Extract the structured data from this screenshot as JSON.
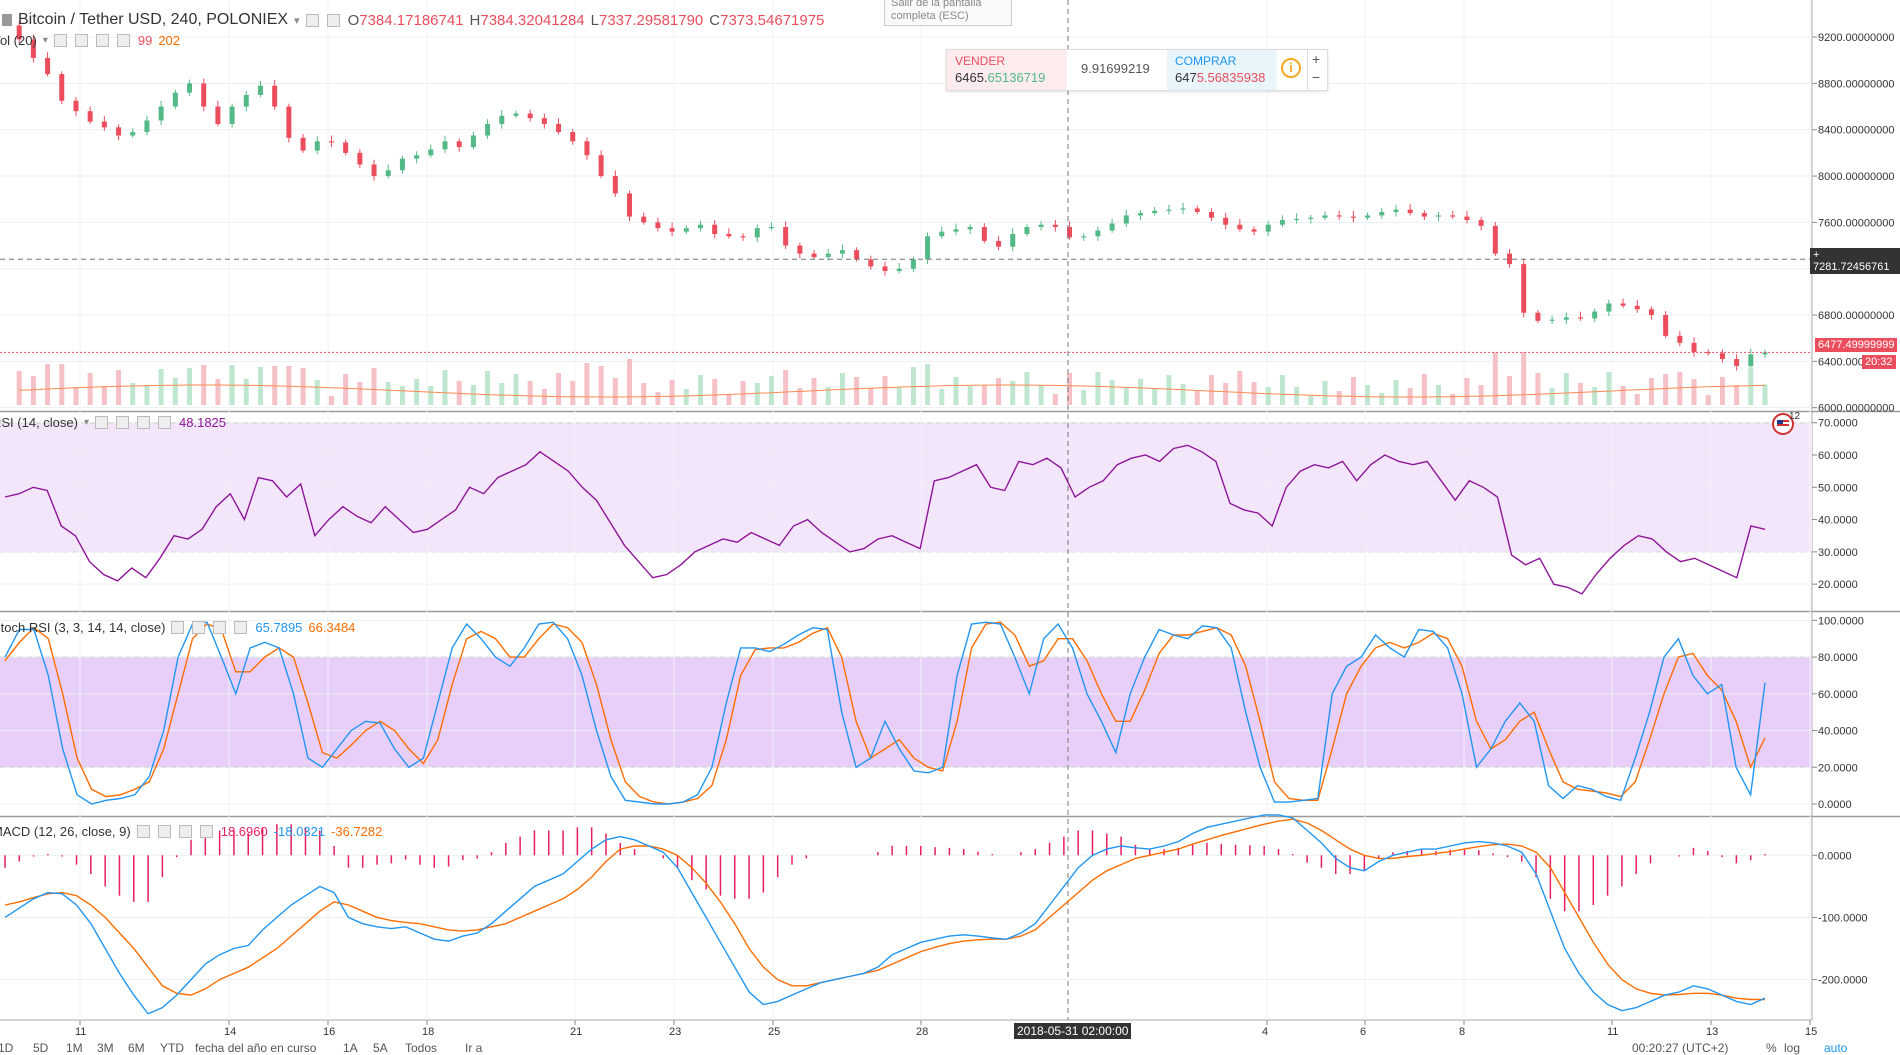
{
  "header": {
    "symbol": "Bitcoin / Tether USD, 240, POLONIEX",
    "ohlc": {
      "o_label": "O",
      "o": "7384.17186741",
      "h_label": "H",
      "h": "7384.32041284",
      "l_label": "L",
      "l": "7337.29581790",
      "c_label": "C",
      "c": "7373.54671975"
    }
  },
  "volume_legend": {
    "label": "Vol (20)",
    "v1": "99",
    "v2": "202"
  },
  "rsi_legend": {
    "label": "RSI (14, close)",
    "value": "48.1825"
  },
  "stoch_legend": {
    "label": "Stoch RSI (3, 3, 14, 14, close)",
    "k": "65.7895",
    "d": "66.3484"
  },
  "macd_legend": {
    "label": "MACD (12, 26, close, 9)",
    "hist": "18.6960",
    "macd": "-18.0321",
    "signal": "-36.7282"
  },
  "tooltip": {
    "text": "Salir de la pantalla completa (ESC)"
  },
  "trade_panel": {
    "sell_label": "VENDER",
    "sell_price_a": "6465.",
    "sell_price_b": "65136719",
    "spread": "9.91699219",
    "buy_label": "COMPRAR",
    "buy_price_a": "647",
    "buy_price_b": "5.56835938",
    "info_icon": "info-icon",
    "plus": "+",
    "minus": "−"
  },
  "price_badges": {
    "crosshair_price": "7281.72456761",
    "last_price": "6477.49999999",
    "countdown": "20:32",
    "flag_count": "12"
  },
  "crosshair_date": "2018-05-31 02:00:00",
  "bottom_bar": {
    "ranges": [
      "1D",
      "5D",
      "1M",
      "3M",
      "6M",
      "YTD",
      "fecha del año en curso",
      "1A",
      "5A",
      "Todos",
      "Ir a"
    ],
    "clock": "00:20:27 (UTC+2)",
    "toggles": [
      "%",
      "log",
      "auto"
    ]
  },
  "colors": {
    "up": "#53b987",
    "down": "#eb4d5c",
    "rsi": "#8e1599",
    "rsi_band": "#f3e6fb",
    "stoch_k": "#2196f3",
    "stoch_d": "#ff6d00",
    "stoch_band": "#e8cffa",
    "macd": "#2196f3",
    "signal": "#ff6d00",
    "hist": "#e91e63"
  },
  "chart_data": [
    {
      "type": "candlestick",
      "title": "Bitcoin / Tether USD, 240, POLONIEX",
      "x_ticks": [
        "11",
        "14",
        "16",
        "18",
        "21",
        "23",
        "25",
        "28",
        "4",
        "6",
        "8",
        "11",
        "13",
        "15"
      ],
      "y_ticks": [
        "9200.00000000",
        "8800.00000000",
        "8400.00000000",
        "8000.00000000",
        "7600.00000000",
        "7200.00000000",
        "6800.00000000",
        "6400.00000000",
        "6000.00000000"
      ],
      "ylim": [
        5980,
        9520
      ],
      "close_path": [
        9300,
        9180,
        9020,
        8880,
        8650,
        8560,
        8470,
        8420,
        8350,
        8380,
        8480,
        8600,
        8720,
        8800,
        8600,
        8450,
        8600,
        8700,
        8780,
        8600,
        8330,
        8220,
        8300,
        8290,
        8200,
        8100,
        8000,
        8050,
        8150,
        8180,
        8230,
        8300,
        8250,
        8350,
        8450,
        8520,
        8540,
        8500,
        8450,
        8380,
        8300,
        8180,
        8000,
        7850,
        7650,
        7600,
        7550,
        7520,
        7550,
        7580,
        7500,
        7480,
        7470,
        7550,
        7560,
        7400,
        7330,
        7300,
        7330,
        7360,
        7280,
        7220,
        7180,
        7200,
        7280,
        7480,
        7520,
        7540,
        7560,
        7440,
        7390,
        7500,
        7560,
        7580,
        7560,
        7470,
        7480,
        7530,
        7590,
        7660,
        7680,
        7700,
        7710,
        7720,
        7690,
        7640,
        7580,
        7540,
        7520,
        7580,
        7620,
        7630,
        7640,
        7660,
        7650,
        7640,
        7660,
        7690,
        7710,
        7680,
        7650,
        7660,
        7650,
        7620,
        7570,
        7330,
        7240,
        6820,
        6750,
        6760,
        6780,
        6770,
        6830,
        6900,
        6880,
        6850,
        6800,
        6620,
        6560,
        6480,
        6470,
        6420,
        6360,
        6460,
        6477
      ]
    },
    {
      "type": "bar",
      "title": "Vol (20)",
      "note": "volume bars with 20-period moving average overlaid on price pane",
      "ylim": [
        0,
        300
      ]
    },
    {
      "type": "line",
      "title": "RSI (14, close)",
      "y_ticks": [
        "70.0000",
        "60.0000",
        "50.0000",
        "40.0000",
        "30.0000",
        "20.0000"
      ],
      "ylim": [
        12,
        73
      ],
      "band": [
        30,
        70
      ],
      "series": [
        {
          "values": [
            47,
            48,
            50,
            49,
            38,
            35,
            27,
            23,
            21,
            25,
            22,
            28,
            35,
            34,
            37,
            44,
            48,
            40,
            53,
            52,
            47,
            51,
            35,
            40,
            44,
            41,
            39,
            44,
            40,
            36,
            37,
            40,
            43,
            50,
            48,
            53,
            55,
            57,
            61,
            58,
            55,
            50,
            46,
            39,
            32,
            27,
            22,
            23,
            26,
            30,
            32,
            34,
            33,
            36,
            34,
            32,
            38,
            40,
            36,
            33,
            30,
            31,
            34,
            35,
            33,
            31,
            52,
            53,
            55,
            57,
            50,
            49,
            58,
            57,
            59,
            56,
            47,
            50,
            52,
            57,
            59,
            60,
            58,
            62,
            63,
            61,
            58,
            45,
            43,
            42,
            38,
            50,
            55,
            57,
            56,
            58,
            52,
            57,
            60,
            58,
            57,
            58,
            52,
            46,
            52,
            50,
            47,
            29,
            26,
            28,
            20,
            19,
            17,
            23,
            28,
            32,
            35,
            34,
            30,
            27,
            28,
            26,
            24,
            22,
            38,
            37
          ]
        }
      ]
    },
    {
      "type": "line",
      "title": "Stoch RSI (3, 3, 14, 14, close)",
      "y_ticks": [
        "100.0000",
        "80.0000",
        "60.0000",
        "40.0000",
        "20.0000",
        "0.0000"
      ],
      "ylim": [
        -6,
        104
      ],
      "band": [
        20,
        80
      ],
      "series": [
        {
          "name": "K",
          "values": [
            80,
            95,
            95,
            70,
            30,
            5,
            0,
            2,
            3,
            5,
            15,
            40,
            80,
            98,
            99,
            80,
            60,
            85,
            88,
            85,
            60,
            25,
            20,
            30,
            40,
            45,
            44,
            30,
            20,
            25,
            55,
            85,
            98,
            90,
            80,
            75,
            85,
            98,
            99,
            90,
            70,
            40,
            15,
            2,
            1,
            0,
            0,
            1,
            5,
            20,
            55,
            85,
            85,
            83,
            87,
            92,
            96,
            95,
            50,
            20,
            25,
            45,
            30,
            18,
            17,
            20,
            70,
            98,
            99,
            98,
            80,
            60,
            90,
            98,
            85,
            60,
            45,
            28,
            60,
            80,
            95,
            92,
            90,
            97,
            96,
            85,
            50,
            20,
            1,
            1,
            2,
            3,
            60,
            75,
            80,
            92,
            85,
            80,
            95,
            94,
            85,
            60,
            20,
            30,
            45,
            55,
            45,
            10,
            3,
            10,
            8,
            4,
            2,
            25,
            50,
            80,
            90,
            70,
            60,
            65,
            20,
            5,
            66
          ]
        },
        {
          "name": "D",
          "values": [
            78,
            88,
            96,
            90,
            60,
            25,
            8,
            4,
            5,
            8,
            12,
            30,
            60,
            90,
            98,
            95,
            72,
            72,
            80,
            85,
            80,
            55,
            28,
            25,
            32,
            40,
            45,
            40,
            30,
            22,
            35,
            65,
            90,
            94,
            90,
            80,
            80,
            90,
            98,
            96,
            88,
            65,
            35,
            12,
            4,
            1,
            0,
            1,
            3,
            10,
            35,
            70,
            84,
            85,
            85,
            88,
            93,
            96,
            80,
            45,
            25,
            30,
            35,
            25,
            20,
            18,
            45,
            85,
            98,
            99,
            92,
            75,
            78,
            90,
            90,
            78,
            60,
            45,
            45,
            62,
            82,
            92,
            92,
            94,
            96,
            92,
            75,
            45,
            12,
            3,
            2,
            2,
            30,
            60,
            75,
            85,
            88,
            85,
            88,
            93,
            90,
            75,
            45,
            30,
            35,
            45,
            50,
            30,
            12,
            8,
            7,
            6,
            4,
            12,
            35,
            60,
            80,
            82,
            70,
            62,
            45,
            20,
            36
          ]
        }
      ]
    },
    {
      "type": "line",
      "title": "MACD (12, 26, close, 9)",
      "y_ticks": [
        "0.0000",
        "-100.0000",
        "-200.0000"
      ],
      "ylim": [
        -265,
        60
      ],
      "series": [
        {
          "name": "MACD",
          "values": [
            -100,
            -85,
            -70,
            -60,
            -62,
            -80,
            -110,
            -150,
            -190,
            -225,
            -255,
            -245,
            -225,
            -200,
            -175,
            -160,
            -150,
            -145,
            -120,
            -100,
            -80,
            -65,
            -50,
            -60,
            -100,
            -110,
            -115,
            -118,
            -115,
            -125,
            -135,
            -138,
            -130,
            -125,
            -110,
            -90,
            -70,
            -50,
            -40,
            -30,
            -10,
            10,
            25,
            30,
            25,
            15,
            5,
            -20,
            -60,
            -100,
            -140,
            -180,
            -220,
            -240,
            -235,
            -225,
            -215,
            -205,
            -200,
            -195,
            -190,
            -180,
            -160,
            -150,
            -140,
            -135,
            -130,
            -128,
            -130,
            -133,
            -135,
            -125,
            -110,
            -80,
            -50,
            -20,
            0,
            10,
            15,
            12,
            10,
            15,
            22,
            35,
            45,
            50,
            55,
            60,
            65,
            65,
            60,
            40,
            20,
            -5,
            -20,
            -25,
            -10,
            0,
            5,
            10,
            10,
            15,
            20,
            22,
            20,
            15,
            5,
            -30,
            -90,
            -150,
            -190,
            -220,
            -240,
            -250,
            -245,
            -235,
            -225,
            -220,
            -210,
            -215,
            -225,
            -235,
            -240,
            -230
          ]
        },
        {
          "name": "Signal",
          "values": [
            -80,
            -75,
            -68,
            -62,
            -60,
            -65,
            -80,
            -100,
            -125,
            -150,
            -180,
            -210,
            -222,
            -225,
            -215,
            -200,
            -190,
            -180,
            -165,
            -150,
            -130,
            -110,
            -90,
            -75,
            -80,
            -90,
            -100,
            -105,
            -108,
            -110,
            -115,
            -120,
            -122,
            -120,
            -115,
            -110,
            -100,
            -90,
            -80,
            -70,
            -55,
            -35,
            -10,
            10,
            15,
            15,
            10,
            0,
            -20,
            -45,
            -75,
            -110,
            -150,
            -180,
            -200,
            -210,
            -210,
            -205,
            -200,
            -195,
            -190,
            -185,
            -175,
            -165,
            -155,
            -148,
            -142,
            -138,
            -136,
            -135,
            -135,
            -130,
            -120,
            -100,
            -80,
            -60,
            -40,
            -25,
            -15,
            -5,
            0,
            5,
            10,
            18,
            25,
            32,
            38,
            44,
            50,
            55,
            58,
            52,
            40,
            25,
            10,
            0,
            -5,
            -5,
            -2,
            0,
            3,
            6,
            10,
            14,
            17,
            18,
            15,
            5,
            -20,
            -60,
            -100,
            -140,
            -175,
            -200,
            -215,
            -222,
            -225,
            -224,
            -222,
            -222,
            -225,
            -230,
            -232,
            -232
          ]
        },
        {
          "name": "Histogram",
          "values": [
            -20,
            -10,
            -2,
            2,
            -2,
            -15,
            -30,
            -50,
            -65,
            -75,
            -75,
            -35,
            -3,
            25,
            40,
            40,
            40,
            35,
            45,
            50,
            50,
            45,
            40,
            15,
            -20,
            -20,
            -15,
            -13,
            -7,
            -15,
            -20,
            -18,
            -8,
            -5,
            5,
            20,
            30,
            40,
            40,
            40,
            45,
            45,
            35,
            20,
            10,
            0,
            -5,
            -20,
            -40,
            -55,
            -65,
            -70,
            -70,
            -60,
            -35,
            -15,
            -5,
            0,
            0,
            0,
            0,
            5,
            15,
            15,
            15,
            13,
            12,
            10,
            6,
            2,
            0,
            5,
            10,
            20,
            30,
            40,
            40,
            35,
            30,
            17,
            10,
            10,
            12,
            17,
            20,
            18,
            17,
            16,
            15,
            10,
            2,
            -12,
            -20,
            -30,
            -30,
            -25,
            -5,
            5,
            7,
            10,
            7,
            9,
            10,
            8,
            3,
            -3,
            -10,
            -35,
            -70,
            -90,
            -90,
            -80,
            -65,
            -50,
            -30,
            -13,
            0,
            -2,
            12,
            7,
            -3,
            -13,
            -8,
            2
          ]
        }
      ]
    }
  ]
}
